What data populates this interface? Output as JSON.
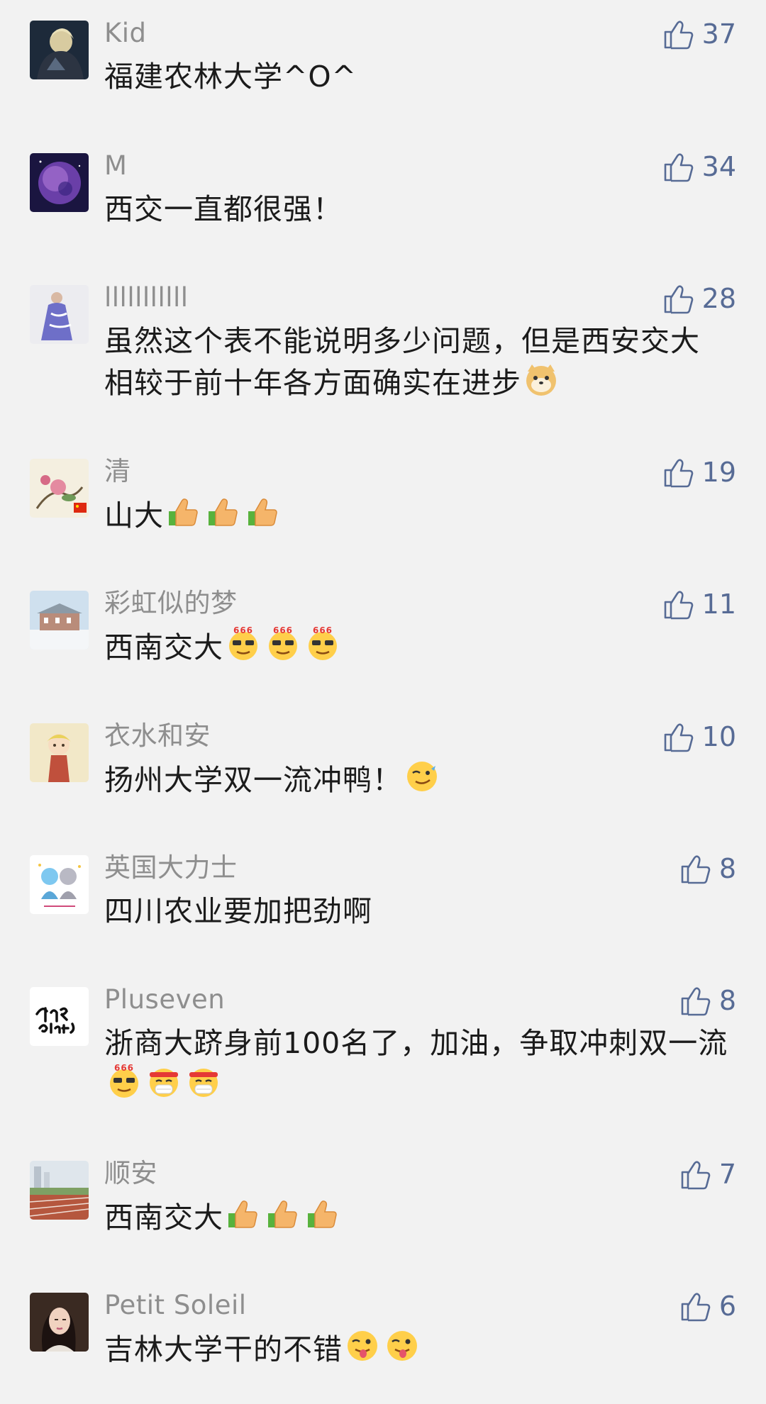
{
  "comments": [
    {
      "name": "Kid",
      "text": "福建农林大学^O^",
      "likes": "37",
      "avatar": "dark-knight-avatar",
      "emojis": []
    },
    {
      "name": "M",
      "text": "西交一直都很强！",
      "likes": "34",
      "avatar": "planet-avatar",
      "emojis": []
    },
    {
      "name": "lllllllllll",
      "text": "虽然这个表不能说明多少问题，但是西安交大相较于前十年各方面确实在进步",
      "likes": "28",
      "avatar": "porcelain-dress-avatar",
      "emojis": [
        "doge"
      ]
    },
    {
      "name": "清",
      "text": "山大",
      "likes": "19",
      "avatar": "peony-painting-avatar",
      "emojis": [
        "thumbs-up",
        "thumbs-up",
        "thumbs-up"
      ]
    },
    {
      "name": "彩虹似的梦",
      "text": "西南交大",
      "likes": "11",
      "avatar": "snow-campus-avatar",
      "emojis": [
        "666",
        "666",
        "666"
      ]
    },
    {
      "name": "衣水和安",
      "text": "扬州大学双一流冲鸭！",
      "likes": "10",
      "avatar": "anime-girl-avatar",
      "emojis": [
        "wink"
      ]
    },
    {
      "name": "英国大力士",
      "text": "四川农业要加把劲啊",
      "likes": "8",
      "avatar": "cartoon-couple-avatar",
      "emojis": []
    },
    {
      "name": "Pluseven",
      "text": "浙商大跻身前100名了，加油，争取冲刺双一流",
      "likes": "8",
      "avatar": "james-blunt-avatar",
      "emojis": [
        "666",
        "fighting",
        "fighting"
      ]
    },
    {
      "name": "顺安",
      "text": "西南交大",
      "likes": "7",
      "avatar": "running-track-avatar",
      "emojis": [
        "thumbs-up",
        "thumbs-up",
        "thumbs-up"
      ]
    },
    {
      "name": "Petit Soleil",
      "text": "吉林大学干的不错",
      "likes": "6",
      "avatar": "portrait-avatar",
      "emojis": [
        "tongue-wink",
        "tongue-wink"
      ]
    }
  ],
  "colors": {
    "background": "#f2f2f2",
    "name": "#8e8e8e",
    "text": "#1b1b1b",
    "like": "#576b95"
  }
}
